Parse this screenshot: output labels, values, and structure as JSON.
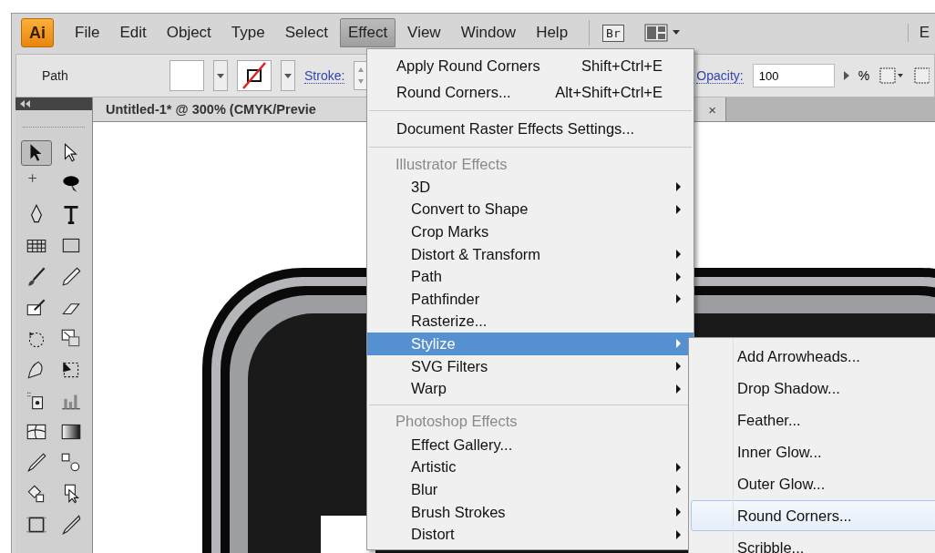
{
  "app_logo": "Ai",
  "menu_bar": [
    {
      "label": "File",
      "selected": false
    },
    {
      "label": "Edit",
      "selected": false
    },
    {
      "label": "Object",
      "selected": false
    },
    {
      "label": "Type",
      "selected": false
    },
    {
      "label": "Select",
      "selected": false
    },
    {
      "label": "Effect",
      "selected": true
    },
    {
      "label": "View",
      "selected": false
    },
    {
      "label": "Window",
      "selected": false
    },
    {
      "label": "Help",
      "selected": false
    }
  ],
  "bridge_button": "Br",
  "workspace_label": "E",
  "control_bar": {
    "selection_label": "Path",
    "stroke_label": "Stroke:",
    "opacity_label": "Opacity:",
    "opacity_value": "100",
    "percent_label": "%"
  },
  "document_tab": {
    "title": "Untitled-1* @ 300% (CMYK/Previe",
    "close": "×"
  },
  "tools": [
    {
      "kind": "selection",
      "selected": true
    },
    {
      "kind": "direct-selection",
      "selected": false
    },
    {
      "kind": "magic-wand",
      "selected": false
    },
    {
      "kind": "lasso",
      "selected": false
    },
    {
      "kind": "pen",
      "selected": false
    },
    {
      "kind": "type",
      "selected": false
    },
    {
      "kind": "grid",
      "selected": false
    },
    {
      "kind": "rectangle",
      "selected": false
    },
    {
      "kind": "brush",
      "selected": false
    },
    {
      "kind": "pencil",
      "selected": false
    },
    {
      "kind": "blob",
      "selected": false
    },
    {
      "kind": "eraser",
      "selected": false
    },
    {
      "kind": "rotate",
      "selected": false
    },
    {
      "kind": "scale",
      "selected": false
    },
    {
      "kind": "warp",
      "selected": false
    },
    {
      "kind": "free-transform",
      "selected": false
    },
    {
      "kind": "spray",
      "selected": false
    },
    {
      "kind": "graph",
      "selected": false
    },
    {
      "kind": "mesh",
      "selected": false
    },
    {
      "kind": "gradient",
      "selected": false
    },
    {
      "kind": "eyedropper",
      "selected": false
    },
    {
      "kind": "blend",
      "selected": false
    },
    {
      "kind": "paint-bucket",
      "selected": false
    },
    {
      "kind": "select-group",
      "selected": false
    },
    {
      "kind": "artboard",
      "selected": false
    },
    {
      "kind": "slice",
      "selected": false
    }
  ],
  "effect_menu": {
    "items": [
      {
        "kind": "command",
        "label": "Apply Round Corners",
        "shortcut": "Shift+Ctrl+E"
      },
      {
        "kind": "command",
        "label": "Round Corners...",
        "shortcut": "Alt+Shift+Ctrl+E"
      },
      {
        "kind": "separator"
      },
      {
        "kind": "command",
        "label": "Document Raster Effects Settings..."
      },
      {
        "kind": "separator"
      },
      {
        "kind": "header",
        "label": "Illustrator Effects"
      },
      {
        "kind": "item",
        "label": "3D",
        "submenu": true,
        "selected": false
      },
      {
        "kind": "item",
        "label": "Convert to Shape",
        "submenu": true,
        "selected": false
      },
      {
        "kind": "item",
        "label": "Crop Marks",
        "submenu": false,
        "selected": false
      },
      {
        "kind": "item",
        "label": "Distort & Transform",
        "submenu": true,
        "selected": false
      },
      {
        "kind": "item",
        "label": "Path",
        "submenu": true,
        "selected": false
      },
      {
        "kind": "item",
        "label": "Pathfinder",
        "submenu": true,
        "selected": false
      },
      {
        "kind": "item",
        "label": "Rasterize...",
        "submenu": false,
        "selected": false
      },
      {
        "kind": "item",
        "label": "Stylize",
        "submenu": true,
        "selected": true
      },
      {
        "kind": "item",
        "label": "SVG Filters",
        "submenu": true,
        "selected": false
      },
      {
        "kind": "item",
        "label": "Warp",
        "submenu": true,
        "selected": false
      },
      {
        "kind": "separator"
      },
      {
        "kind": "header",
        "label": "Photoshop Effects"
      },
      {
        "kind": "item",
        "label": "Effect Gallery...",
        "submenu": false,
        "selected": false
      },
      {
        "kind": "item",
        "label": "Artistic",
        "submenu": true,
        "selected": false
      },
      {
        "kind": "item",
        "label": "Blur",
        "submenu": true,
        "selected": false
      },
      {
        "kind": "item",
        "label": "Brush Strokes",
        "submenu": true,
        "selected": false
      },
      {
        "kind": "item",
        "label": "Distort",
        "submenu": true,
        "selected": false
      }
    ]
  },
  "stylize_submenu": {
    "items": [
      {
        "label": "Add Arrowheads...",
        "selected": false
      },
      {
        "label": "Drop Shadow...",
        "selected": false
      },
      {
        "label": "Feather...",
        "selected": false
      },
      {
        "label": "Inner Glow...",
        "selected": false
      },
      {
        "label": "Outer Glow...",
        "selected": false
      },
      {
        "label": "Round Corners...",
        "selected": true
      },
      {
        "label": "Scribble...",
        "selected": false
      }
    ]
  }
}
